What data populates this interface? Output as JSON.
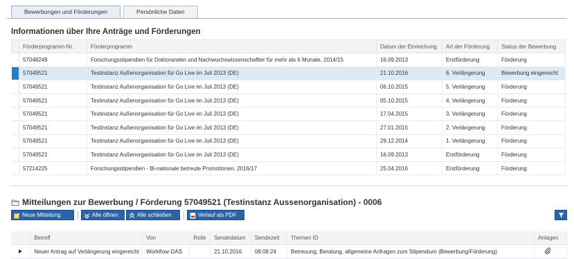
{
  "tabs": [
    {
      "label": "Bewerbungen und Förderungen",
      "active": true
    },
    {
      "label": "Persönliche Daten",
      "active": false
    }
  ],
  "applications": {
    "title": "Informationen über Ihre Anträge und Förderungen",
    "columns": [
      "Förderprogramm-Nr.",
      "Förderprogramm",
      "Datum der Einreichung",
      "Art der Förderung",
      "Status der Bewerbung"
    ],
    "rows": [
      {
        "nr": "57048249",
        "programm": "Forschungsstipendien für Doktoranden und Nachwuchswissenschaftler für mehr als 6 Monate, 2014/15",
        "datum": "16.09.2013",
        "art": "Erstförderung",
        "status": "Förderung"
      },
      {
        "nr": "57049521",
        "programm": "Testinstanz Außenorganisation für Go Live im Juli 2013 (DE)",
        "datum": "21.10.2016",
        "art": "6. Verlängerung",
        "status": "Bewerbung eingereicht"
      },
      {
        "nr": "57049521",
        "programm": "Testinstanz Außenorganisation für Go Live im Juli 2013 (DE)",
        "datum": "06.10.2015",
        "art": "5. Verlängerung",
        "status": "Förderung"
      },
      {
        "nr": "57049521",
        "programm": "Testinstanz Außenorganisation für Go Live im Juli 2013 (DE)",
        "datum": "05.10.2015",
        "art": "4. Verlängerung",
        "status": "Förderung"
      },
      {
        "nr": "57049521",
        "programm": "Testinstanz Außenorganisation für Go Live im Juli 2013 (DE)",
        "datum": "17.04.2015",
        "art": "3. Verlängerung",
        "status": "Förderung"
      },
      {
        "nr": "57049521",
        "programm": "Testinstanz Außenorganisation für Go Live im Juli 2013 (DE)",
        "datum": "27.01.2015",
        "art": "2. Verlängerung",
        "status": "Förderung"
      },
      {
        "nr": "57049521",
        "programm": "Testinstanz Außenorganisation für Go Live im Juli 2013 (DE)",
        "datum": "29.12.2014",
        "art": "1. Verlängerung",
        "status": "Förderung"
      },
      {
        "nr": "57049521",
        "programm": "Testinstanz Außenorganisation für Go Live im Juli 2013 (DE)",
        "datum": "16.09.2013",
        "art": "Erstförderung",
        "status": "Förderung"
      },
      {
        "nr": "57214225",
        "programm": "Forschungsstipendien - Bi-nationale betreute Promotionen, 2016/17",
        "datum": "25.04.2016",
        "art": "Erstförderung",
        "status": "Förderung"
      }
    ],
    "selected_row_index": 1
  },
  "messages": {
    "title": "Mitteilungen zur Bewerbung / Förderung 57049521 (Testinstanz Aussenorganisation) - 0006",
    "title_icon": "folder-icon",
    "toolbar": {
      "new_message": "Neue Mitteilung",
      "open_all": "Alle öffnen",
      "close_all": "Alle schließen",
      "export_pdf": "Verlauf als PDF"
    },
    "columns": [
      "Betreff",
      "Von",
      "Rolle",
      "Sendedatum",
      "Sendezeit",
      "Themen ID",
      "Anlagen"
    ],
    "rows": [
      {
        "betreff": "Neuer Antrag auf Verlängerung eingereicht",
        "von": "Workflow-DAS",
        "rolle": "",
        "datum": "21.10.2016",
        "zeit": "08:08:24",
        "thema": "Betreuung, Beratung, allgemeine Anfragen zum Stipendium (Bewerbung/Förderung)",
        "anlagen_icon": "paperclip-icon"
      }
    ]
  },
  "colors": {
    "accent": "#2a63a8",
    "selection": "#2a7cc4",
    "selected_row_bg": "#dde9f5"
  }
}
